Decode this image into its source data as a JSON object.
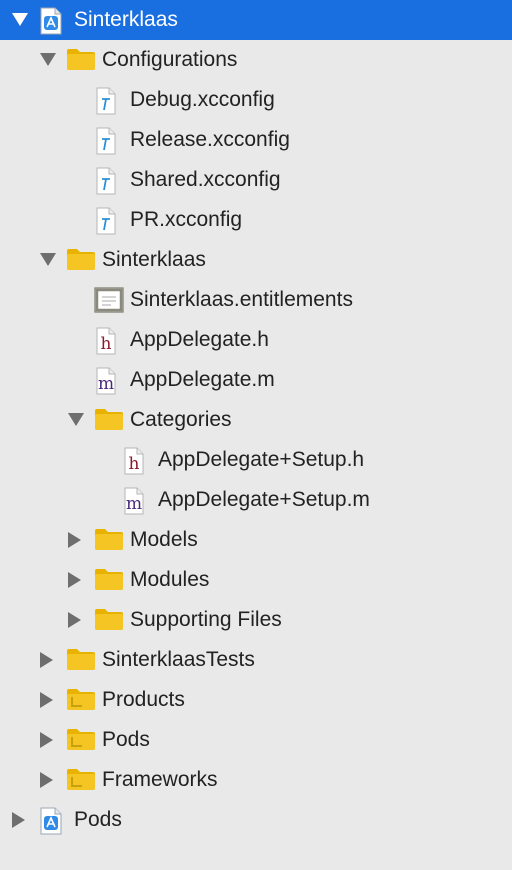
{
  "tree": [
    {
      "label": "Sinterklaas",
      "type": "project",
      "level": 0,
      "expander": "open",
      "selected": true
    },
    {
      "label": "Configurations",
      "type": "folder",
      "level": 1,
      "expander": "open"
    },
    {
      "label": "Debug.xcconfig",
      "type": "xcconfig",
      "level": 2,
      "expander": "none"
    },
    {
      "label": "Release.xcconfig",
      "type": "xcconfig",
      "level": 2,
      "expander": "none"
    },
    {
      "label": "Shared.xcconfig",
      "type": "xcconfig",
      "level": 2,
      "expander": "none"
    },
    {
      "label": "PR.xcconfig",
      "type": "xcconfig",
      "level": 2,
      "expander": "none"
    },
    {
      "label": "Sinterklaas",
      "type": "folder",
      "level": 1,
      "expander": "open"
    },
    {
      "label": "Sinterklaas.entitlements",
      "type": "entitlements",
      "level": 2,
      "expander": "none"
    },
    {
      "label": "AppDelegate.h",
      "type": "header",
      "level": 2,
      "expander": "none"
    },
    {
      "label": "AppDelegate.m",
      "type": "implementation",
      "level": 2,
      "expander": "none"
    },
    {
      "label": "Categories",
      "type": "folder",
      "level": 2,
      "expander": "open"
    },
    {
      "label": "AppDelegate+Setup.h",
      "type": "header",
      "level": 3,
      "expander": "none"
    },
    {
      "label": "AppDelegate+Setup.m",
      "type": "implementation",
      "level": 3,
      "expander": "none"
    },
    {
      "label": "Models",
      "type": "folder",
      "level": 2,
      "expander": "closed"
    },
    {
      "label": "Modules",
      "type": "folder",
      "level": 2,
      "expander": "closed"
    },
    {
      "label": "Supporting Files",
      "type": "folder",
      "level": 2,
      "expander": "closed"
    },
    {
      "label": "SinterklaasTests",
      "type": "folder",
      "level": 1,
      "expander": "closed"
    },
    {
      "label": "Products",
      "type": "folder-dark",
      "level": 1,
      "expander": "closed"
    },
    {
      "label": "Pods",
      "type": "folder-dark",
      "level": 1,
      "expander": "closed"
    },
    {
      "label": "Frameworks",
      "type": "folder-dark",
      "level": 1,
      "expander": "closed"
    },
    {
      "label": "Pods",
      "type": "project",
      "level": 0,
      "expander": "closed"
    }
  ],
  "icons": {
    "project": "xcode-project-icon",
    "folder": "folder-icon",
    "folder-dark": "group-folder-icon",
    "xcconfig": "xcconfig-file-icon",
    "entitlements": "entitlements-file-icon",
    "header": "header-file-icon",
    "implementation": "implementation-file-icon"
  },
  "colors": {
    "selection": "#1a6fe0",
    "folder": "#f5c623",
    "header_letter": "#8b1a2b",
    "implementation_letter": "#4b2a7a",
    "xcconfig_accent": "#2a8fd6"
  }
}
